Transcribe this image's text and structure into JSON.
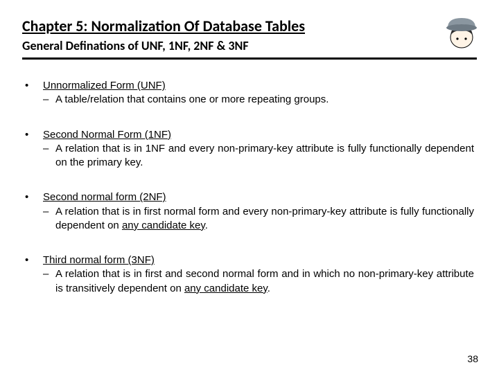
{
  "header": {
    "chapter_title": "Chapter 5: Normalization Of Database Tables",
    "subtitle": "General Definations of UNF, 1NF, 2NF & 3NF"
  },
  "items": [
    {
      "term": "Unnormalized Form (UNF)",
      "desc_pre": "A table/relation that contains one or more repeating groups.",
      "desc_uline": "",
      "desc_post": ""
    },
    {
      "term": "Second Normal Form (1NF)",
      "desc_pre": "A relation that is in 1NF and every non-primary-key attribute is fully functionally dependent on the primary key.",
      "desc_uline": "",
      "desc_post": ""
    },
    {
      "term": "Second normal form (2NF)",
      "desc_pre": "A relation that is in first normal form and every non-primary-key attribute is fully functionally dependent on ",
      "desc_uline": "any candidate key",
      "desc_post": "."
    },
    {
      "term": "Third normal form (3NF)",
      "desc_pre": "A relation that is in first and second normal form and in which no non-primary-key attribute is transitively dependent on ",
      "desc_uline": "any candidate key",
      "desc_post": "."
    }
  ],
  "page_number": "38"
}
